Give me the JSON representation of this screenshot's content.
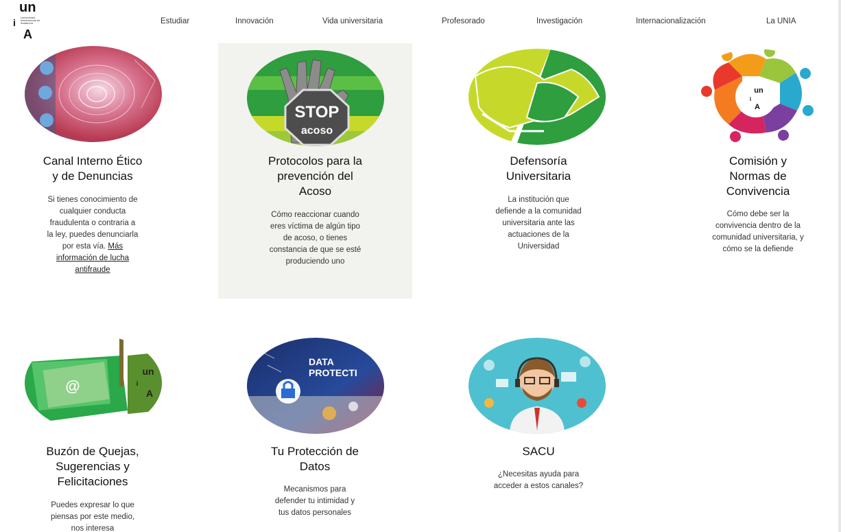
{
  "logo": {
    "top": "un",
    "left": "i",
    "bottom": "A",
    "small_text": "Universidad Internacional de Andalucía"
  },
  "nav": {
    "items": [
      "Estudiar",
      "Innovación",
      "Vida universitaria",
      "Profesorado",
      "Investigación",
      "Internacionalización",
      "La UNIA"
    ]
  },
  "cards": [
    {
      "title": "Canal Interno Ético y de Denuncias",
      "title_lines": [
        "Canal Interno Ético",
        "y de Denuncias"
      ],
      "desc_lines": [
        "Si tienes conocimiento de",
        "cualquier conducta",
        "fraudulenta o contraria a",
        "la ley, puedes denunciarla",
        "por esta vía."
      ],
      "link_lines": [
        "Más",
        "información de lucha",
        "antifraude"
      ],
      "image": "fingerprint-tech-image"
    },
    {
      "title_lines": [
        "Protocolos para la",
        "prevención del",
        "Acoso"
      ],
      "desc_lines": [
        "Cómo reaccionar cuando",
        "eres víctima de algún tipo",
        "de acoso, o tienes",
        "constancia de que se esté",
        "produciendo uno"
      ],
      "image": "stop-acoso-image",
      "image_text": [
        "STOP",
        "acoso"
      ]
    },
    {
      "title_lines": [
        "Defensoría",
        "Universitaria"
      ],
      "desc_lines": [
        "La institución que",
        "defiende a la comunidad",
        "universitaria ante las",
        "actuaciones de la",
        "Universidad"
      ],
      "image": "handshake-image"
    },
    {
      "title_lines": [
        "Comisión y",
        "Normas de",
        "Convivencia"
      ],
      "desc_lines": [
        "Cómo debe ser la",
        "convivencia dentro de la",
        "comunidad universitaria, y",
        "cómo se la defiende"
      ],
      "image": "community-circle-image",
      "image_text": [
        "un",
        "i",
        "A"
      ]
    },
    {
      "title_lines": [
        "Buzón de Quejas,",
        "Sugerencias y",
        "Felicitaciones"
      ],
      "desc_lines": [
        "Puedes expresar lo que",
        "piensas por este medio,",
        "nos interesa"
      ],
      "image": "mailbox-image",
      "image_text": [
        "@",
        "un",
        "i",
        "A"
      ]
    },
    {
      "title_lines": [
        "Tu Protección de",
        "Datos"
      ],
      "desc_lines": [
        "Mecanismos para",
        "defender tu intimidad y",
        "tus datos personales"
      ],
      "image": "data-protection-image",
      "image_text": [
        "DATA",
        "PROTECTI"
      ]
    },
    {
      "title_lines": [
        "SACU"
      ],
      "desc_lines": [
        "¿Necesitas ayuda para",
        "acceder a estos canales?"
      ],
      "image": "support-agent-image"
    }
  ],
  "colors": {
    "highlight_bg": "#f2f2ee",
    "green": "#2e9e3e",
    "yellow_green": "#c6d92b",
    "teal": "#4fc0cf"
  }
}
